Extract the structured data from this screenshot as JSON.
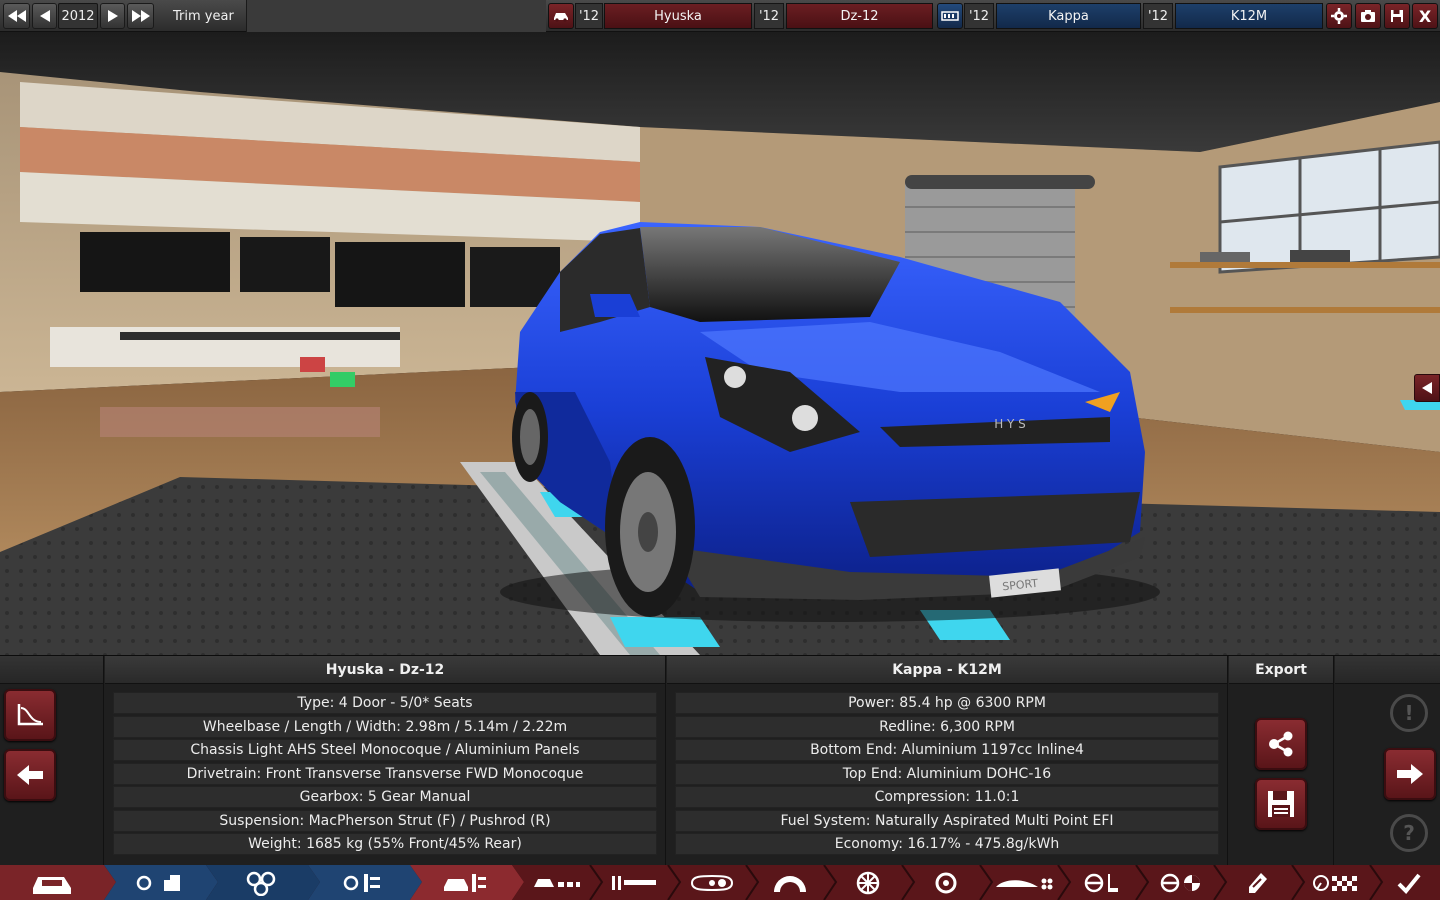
{
  "topbar": {
    "year": "2012",
    "trim_label": "Trim year",
    "model_year": "'12",
    "model_make": "Hyuska",
    "model_year2": "'12",
    "model_name": "Dz-12",
    "engine_year": "'12",
    "engine_family": "Kappa",
    "engine_year2": "'12",
    "engine_variant": "K12M",
    "close_label": "X"
  },
  "model": {
    "title": "Hyuska - Dz-12",
    "specs": [
      "Type: 4 Door - 5/0* Seats",
      "Wheelbase / Length / Width: 2.98m / 5.14m / 2.22m",
      "Chassis Light AHS Steel Monocoque / Aluminium Panels",
      "Drivetrain: Front Transverse Transverse FWD Monocoque",
      "Gearbox: 5 Gear Manual",
      "Suspension: MacPherson Strut (F) / Pushrod (R)",
      "Weight: 1685 kg (55% Front/45% Rear)"
    ]
  },
  "engine": {
    "title": "Kappa - K12M",
    "specs": [
      "Power: 85.4 hp @ 6300 RPM",
      "Redline:  6,300 RPM",
      "Bottom End: Aluminium 1197cc Inline4",
      "Top End: Aluminium DOHC-16",
      "Compression: 11.0:1",
      "Fuel System: Naturally Aspirated Multi Point EFI",
      "Economy: 16.17% - 475.8g/kWh"
    ]
  },
  "export": {
    "title": "Export"
  },
  "help": {
    "question": "?",
    "alert": "!"
  },
  "car": {
    "badge": "H Y S",
    "plate": "SPORT"
  },
  "colors": {
    "accent_red": "#7a2428",
    "accent_blue": "#1d3f6a",
    "car_blue": "#1a3fd6",
    "cyan": "#3fd6ee"
  }
}
